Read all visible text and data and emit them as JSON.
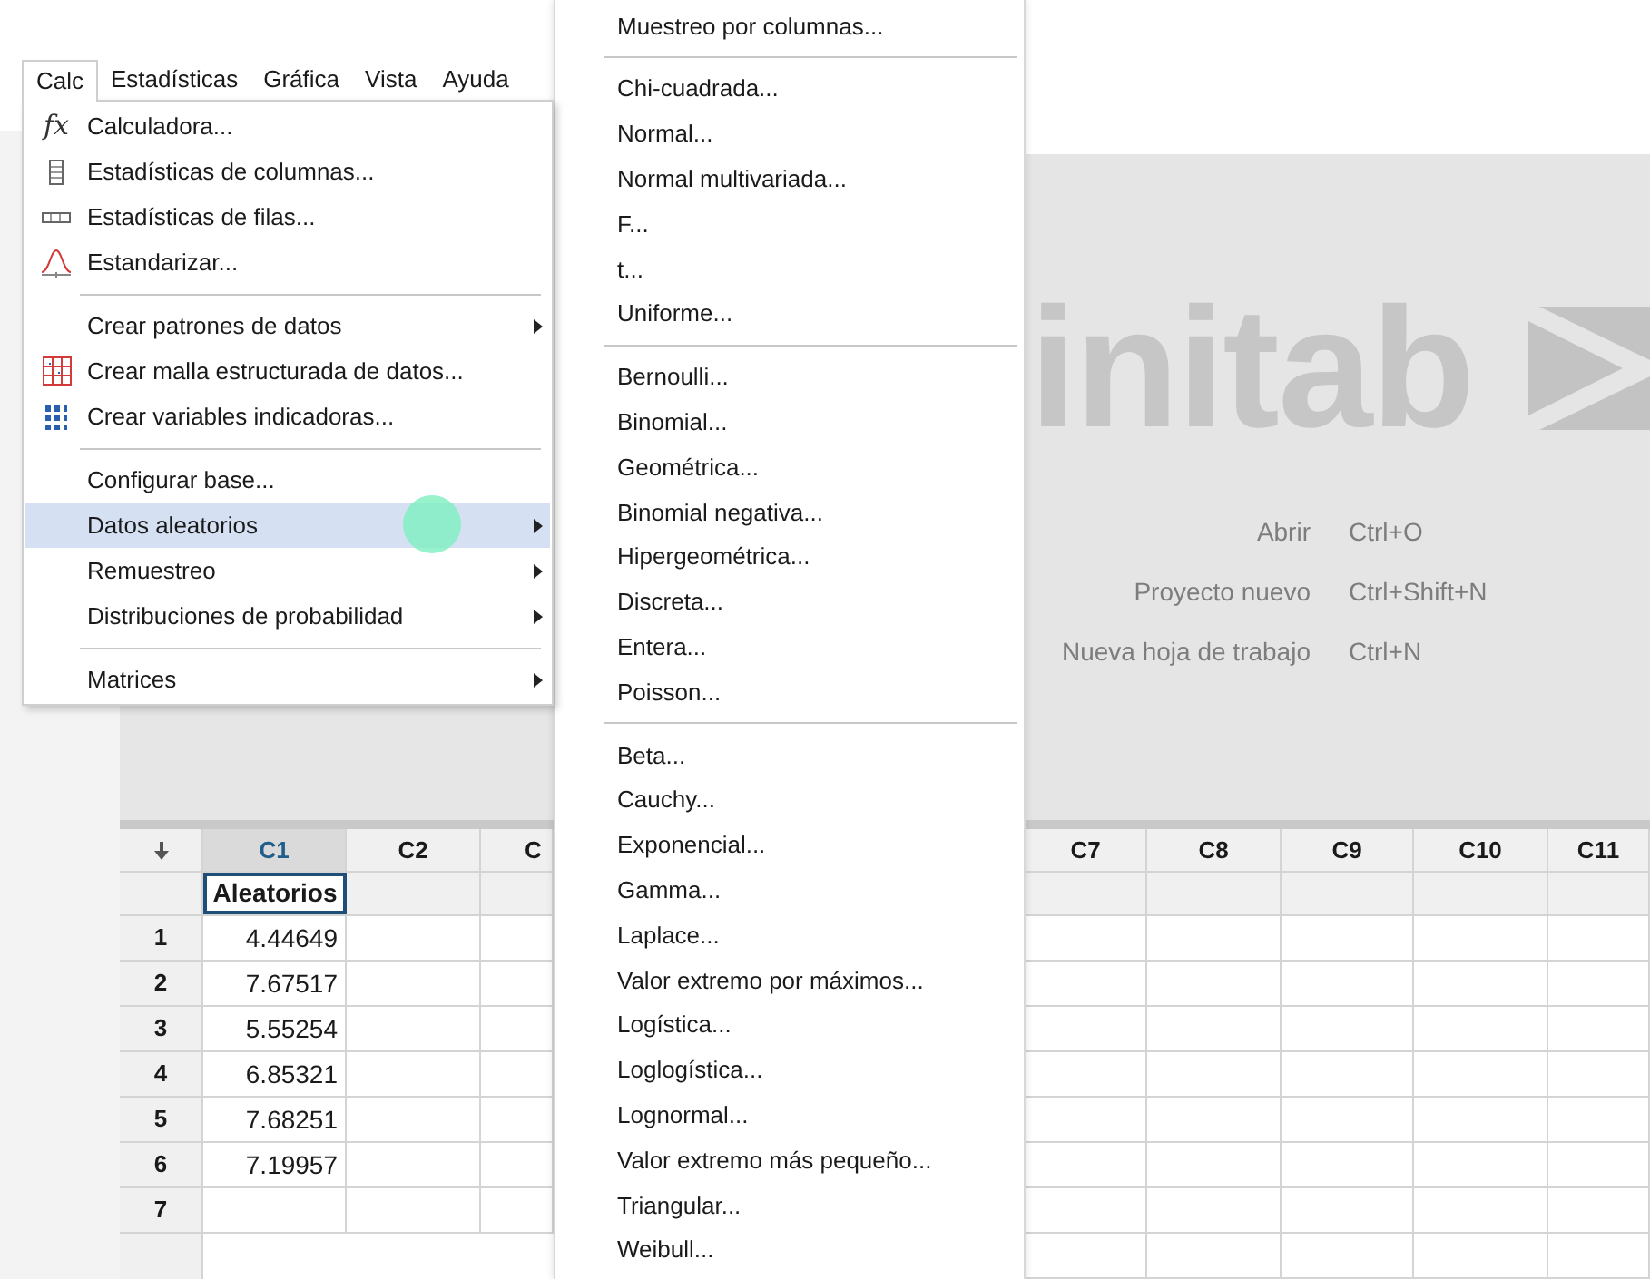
{
  "menu_bar": [
    {
      "label": "Calc",
      "selected": true
    },
    {
      "label": "Estadísticas",
      "selected": false
    },
    {
      "label": "Gráfica",
      "selected": false
    },
    {
      "label": "Vista",
      "selected": false
    },
    {
      "label": "Ayuda",
      "selected": false
    }
  ],
  "calc_menu": {
    "groups": [
      [
        {
          "label": "Calculadora...",
          "icon_text": "fx",
          "submenu": false,
          "selected": false
        },
        {
          "label": "Estadísticas de columnas...",
          "submenu": false,
          "selected": false
        },
        {
          "label": "Estadísticas de filas...",
          "submenu": false,
          "selected": false
        },
        {
          "label": "Estandarizar...",
          "submenu": false,
          "selected": false
        }
      ],
      [
        {
          "label": "Crear patrones de datos",
          "submenu": true,
          "selected": false
        },
        {
          "label": "Crear malla estructurada de datos...",
          "submenu": false,
          "selected": false
        },
        {
          "label": "Crear variables indicadoras...",
          "submenu": false,
          "selected": false
        }
      ],
      [
        {
          "label": "Configurar base...",
          "submenu": false,
          "selected": false
        },
        {
          "label": "Datos aleatorios",
          "submenu": true,
          "selected": true
        },
        {
          "label": "Remuestreo",
          "submenu": true,
          "selected": false
        },
        {
          "label": "Distribuciones de probabilidad",
          "submenu": true,
          "selected": false
        }
      ],
      [
        {
          "label": "Matrices",
          "submenu": true,
          "selected": false
        }
      ]
    ]
  },
  "submenu": {
    "groups": [
      [
        "Muestreo por columnas..."
      ],
      [
        "Chi-cuadrada...",
        "Normal...",
        "Normal multivariada...",
        "F...",
        "t...",
        "Uniforme..."
      ],
      [
        "Bernoulli...",
        "Binomial...",
        "Geométrica...",
        "Binomial negativa...",
        "Hipergeométrica...",
        "Discreta...",
        "Entera...",
        "Poisson..."
      ],
      [
        "Beta...",
        "Cauchy...",
        "Exponencial...",
        "Gamma...",
        "Laplace...",
        "Valor extremo por máximos...",
        "Logística...",
        "Loglogística...",
        "Lognormal...",
        "Valor extremo más pequeño...",
        "Triangular...",
        "Weibull..."
      ]
    ]
  },
  "welcome": {
    "logo": "initab",
    "shortcuts": [
      {
        "action": "Abrir",
        "keys": "Ctrl+O"
      },
      {
        "action": "Proyecto nuevo",
        "keys": "Ctrl+Shift+N"
      },
      {
        "action": "Nueva hoja de trabajo",
        "keys": "Ctrl+N"
      }
    ]
  },
  "worksheet": {
    "left_columns": [
      {
        "label": "C1",
        "selected": true,
        "name": "Aleatorios",
        "name_active": true
      },
      {
        "label": "C2",
        "selected": false
      },
      {
        "label": "C",
        "selected": false
      }
    ],
    "right_columns": [
      {
        "label": "C7",
        "selected": false
      },
      {
        "label": "C8",
        "selected": false
      },
      {
        "label": "C9",
        "selected": false
      },
      {
        "label": "C10",
        "selected": false
      },
      {
        "label": "C11",
        "selected": false
      }
    ],
    "rows": [
      {
        "number": "1",
        "values": [
          "4.44649"
        ]
      },
      {
        "number": "2",
        "values": [
          "7.67517"
        ]
      },
      {
        "number": "3",
        "values": [
          "5.55254"
        ]
      },
      {
        "number": "4",
        "values": [
          "6.85321"
        ]
      },
      {
        "number": "5",
        "values": [
          "7.68251"
        ]
      },
      {
        "number": "6",
        "values": [
          "7.19957"
        ]
      },
      {
        "number": "7",
        "values": []
      }
    ]
  }
}
